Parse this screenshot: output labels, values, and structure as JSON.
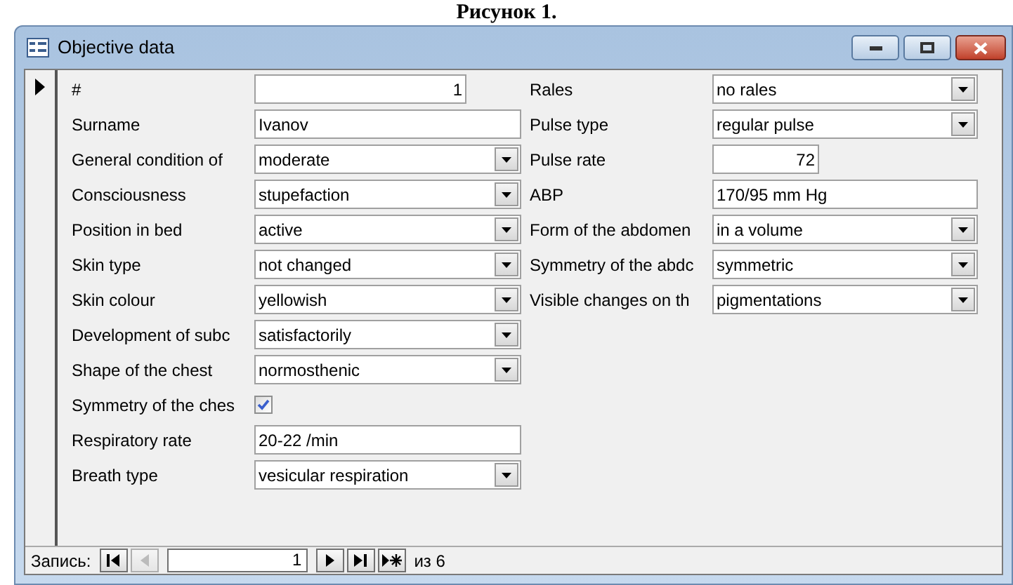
{
  "caption": "Рисунок 1.",
  "window": {
    "title": "Objective data"
  },
  "left_fields": [
    {
      "label": "#",
      "kind": "number",
      "value": "1"
    },
    {
      "label": "Surname",
      "kind": "text",
      "value": "Ivanov"
    },
    {
      "label": "General condition of",
      "kind": "combo",
      "value": "moderate"
    },
    {
      "label": "Consciousness",
      "kind": "combo",
      "value": "stupefaction"
    },
    {
      "label": "Position in bed",
      "kind": "combo",
      "value": "active"
    },
    {
      "label": "Skin type",
      "kind": "combo",
      "value": "not changed"
    },
    {
      "label": "Skin colour",
      "kind": "combo",
      "value": "yellowish"
    },
    {
      "label": "Development of subc",
      "kind": "combo",
      "value": "satisfactorily"
    },
    {
      "label": "Shape of the chest",
      "kind": "combo",
      "value": "normosthenic"
    },
    {
      "label": "Symmetry of the ches",
      "kind": "checkbox",
      "checked": true
    },
    {
      "label": "Respiratory rate",
      "kind": "text",
      "value": "20-22 /min"
    },
    {
      "label": "Breath type",
      "kind": "combo",
      "value": "vesicular respiration"
    }
  ],
  "right_fields": [
    {
      "label": "Rales",
      "kind": "combo",
      "value": "no rales"
    },
    {
      "label": "Pulse type",
      "kind": "combo",
      "value": "regular pulse"
    },
    {
      "label": "Pulse rate",
      "kind": "number",
      "value": "72"
    },
    {
      "label": "ABP",
      "kind": "text",
      "value": "170/95 mm Hg"
    },
    {
      "label": "Form of the abdomen",
      "kind": "combo",
      "value": "in a volume"
    },
    {
      "label": "Symmetry of the abdc",
      "kind": "combo",
      "value": "symmetric"
    },
    {
      "label": "Visible changes on th",
      "kind": "combo",
      "value": "pigmentations"
    }
  ],
  "navigation": {
    "label": "Запись:",
    "current": "1",
    "total_label": "из 6",
    "first_disabled": false,
    "prev_disabled": true
  }
}
